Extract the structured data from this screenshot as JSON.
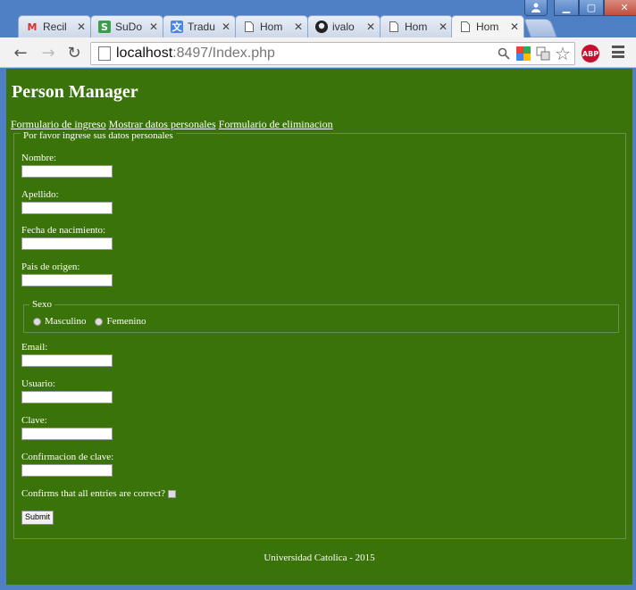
{
  "browser": {
    "tabs": [
      {
        "label": "Recil",
        "icon": "gmail-icon"
      },
      {
        "label": "SuDo",
        "icon": "sheets-icon"
      },
      {
        "label": "Tradu",
        "icon": "translate-icon"
      },
      {
        "label": "Hom",
        "icon": "page-icon"
      },
      {
        "label": "ivalo",
        "icon": "github-icon"
      },
      {
        "label": "Hom",
        "icon": "page-icon"
      },
      {
        "label": "Hom",
        "icon": "page-icon"
      }
    ],
    "active_tab_index": 6,
    "url_host": "localhost",
    "url_rest": ":8497/Index.php",
    "abp_label": "ABP"
  },
  "page": {
    "title": "Person Manager",
    "nav_links": [
      "Formulario de ingreso",
      "Mostrar datos personales",
      "Formulario de eliminacion"
    ],
    "form_legend": "Por favor ingrese sus datos personales",
    "fields": {
      "nombre": "Nombre:",
      "apellido": "Apellido:",
      "fecha": "Fecha de nacimiento:",
      "pais": "Pais de origen:",
      "email": "Email:",
      "usuario": "Usuario:",
      "clave": "Clave:",
      "confirmacion": "Confirmacion de clave:"
    },
    "sexo": {
      "legend": "Sexo",
      "options": [
        "Masculino",
        "Femenino"
      ]
    },
    "confirm_label": "Confirms that all entries are correct?",
    "submit_label": "Submit",
    "footer": "Universidad Catolica - 2015"
  },
  "colors": {
    "page_background": "#3a7309",
    "window_frame": "#4f7fc4"
  }
}
